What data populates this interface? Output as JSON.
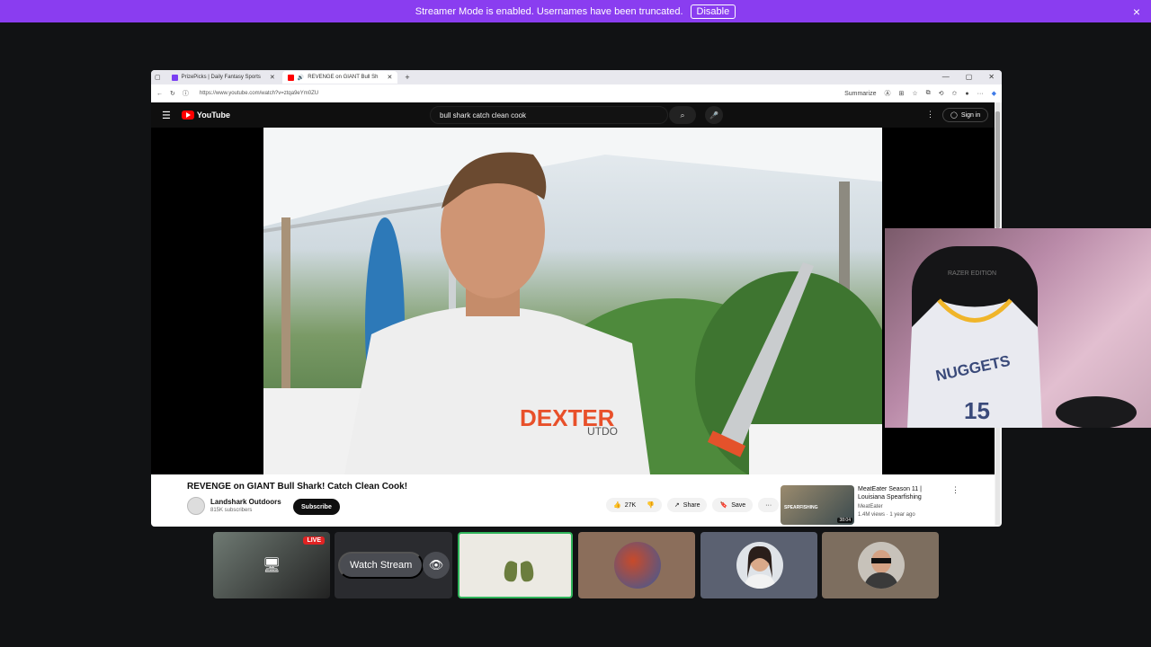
{
  "banner": {
    "message": "Streamer Mode is enabled. Usernames have been truncated.",
    "disable_label": "Disable",
    "close_icon": "×",
    "color": "#8a3df0"
  },
  "browser": {
    "tabs": [
      {
        "label": "PrizePicks | Daily Fantasy Sports",
        "favicon": "prizepicks-icon"
      },
      {
        "label": "REVENGE on GIANT Bull Sh",
        "favicon": "youtube-icon",
        "active": true
      }
    ],
    "new_tab": "+",
    "url": "https://www.youtube.com/watch?v=ztqa9eYm0ZU",
    "summarize_label": "Summarize"
  },
  "youtube": {
    "logo_text": "YouTube",
    "search_value": "bull shark catch clean cook",
    "signin_label": "Sign in",
    "video_title": "REVENGE on GIANT Bull Shark! Catch Clean Cook!",
    "channel_name": "Landshark Outdoors",
    "channel_subs": "815K subscribers",
    "subscribe_label": "Subscribe",
    "likes": "27K",
    "share_label": "Share",
    "save_label": "Save",
    "recommendation": {
      "title": "MeatEater Season 11 | Louisiana Spearfishing",
      "channel": "MeatEater",
      "meta": "1.4M views · 1 year ago",
      "duration": "38:04",
      "overlay": "SPEARFISHING"
    },
    "shirt_text": "DEXTER",
    "shirt_sub": "UTDO"
  },
  "webcam": {
    "jersey_team": "NUGGETS",
    "jersey_number": "15",
    "chair_brand": "RAZER EDITION"
  },
  "participants": {
    "live_label": "LIVE",
    "watch_stream_label": "Watch Stream"
  }
}
